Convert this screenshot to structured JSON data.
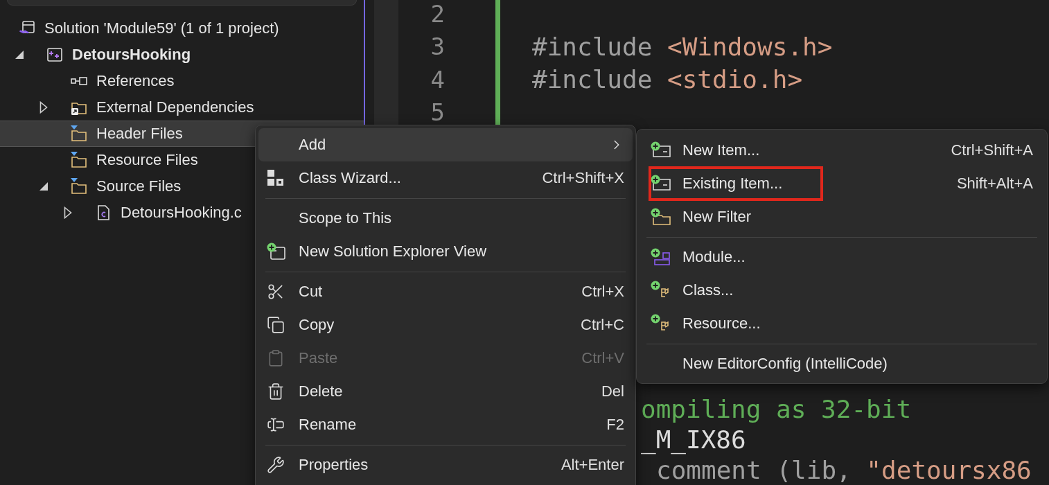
{
  "tree": [
    {
      "label": "Solution 'Module59' (1 of 1 project)",
      "kind": "solution",
      "selected": false,
      "children": [
        {
          "label": "DetoursHooking",
          "kind": "project",
          "selected": false,
          "expanded": true,
          "children": [
            {
              "label": "References",
              "kind": "references",
              "selected": false
            },
            {
              "label": "External Dependencies",
              "kind": "external",
              "selected": false,
              "expanded": false
            },
            {
              "label": "Header Files",
              "kind": "filter",
              "selected": true
            },
            {
              "label": "Resource Files",
              "kind": "filter",
              "selected": false
            },
            {
              "label": "Source Files",
              "kind": "filter",
              "selected": false,
              "expanded": true,
              "children": [
                {
                  "label": "DetoursHooking.c",
                  "kind": "cfile",
                  "selected": false,
                  "expanded": false
                }
              ]
            }
          ]
        }
      ]
    }
  ],
  "editor": {
    "lines": [
      {
        "number": "2"
      },
      {
        "number": "3",
        "tokens": [
          {
            "text": "#include",
            "kind": "directive"
          },
          {
            "text": "<Windows.h>",
            "kind": "string"
          }
        ]
      },
      {
        "number": "4",
        "tokens": [
          {
            "text": "#include",
            "kind": "directive"
          },
          {
            "text": "<stdio.h>",
            "kind": "string"
          }
        ]
      },
      {
        "number": "5"
      }
    ],
    "partial_lines": [
      {
        "tokens": [
          {
            "text": "ompiling as 32-bit",
            "kind": "comment"
          }
        ]
      },
      {
        "tokens": [
          {
            "text": "_M_IX86",
            "kind": "plain"
          }
        ]
      },
      {
        "tokens": [
          {
            "text": "comment (lib,",
            "kind": "directive"
          },
          {
            "text": "\"detoursx86",
            "kind": "string"
          }
        ]
      }
    ]
  },
  "context_menu": {
    "items": [
      {
        "kind": "item",
        "label": "Add",
        "submenu": true,
        "selected": true,
        "disabled": false
      },
      {
        "kind": "item",
        "label": "Class Wizard...",
        "shortcut": "Ctrl+Shift+X",
        "selected": false,
        "disabled": false
      },
      {
        "kind": "separator"
      },
      {
        "kind": "item",
        "label": "Scope to This",
        "selected": false,
        "disabled": false
      },
      {
        "kind": "item",
        "label": "New Solution Explorer View",
        "selected": false,
        "disabled": false
      },
      {
        "kind": "separator"
      },
      {
        "kind": "item",
        "label": "Cut",
        "shortcut": "Ctrl+X",
        "selected": false,
        "disabled": false
      },
      {
        "kind": "item",
        "label": "Copy",
        "shortcut": "Ctrl+C",
        "selected": false,
        "disabled": false
      },
      {
        "kind": "item",
        "label": "Paste",
        "shortcut": "Ctrl+V",
        "selected": false,
        "disabled": true
      },
      {
        "kind": "item",
        "label": "Delete",
        "shortcut": "Del",
        "selected": false,
        "disabled": false
      },
      {
        "kind": "item",
        "label": "Rename",
        "shortcut": "F2",
        "selected": false,
        "disabled": false
      },
      {
        "kind": "separator"
      },
      {
        "kind": "item",
        "label": "Properties",
        "shortcut": "Alt+Enter",
        "selected": false,
        "disabled": false
      }
    ]
  },
  "add_submenu": {
    "items": [
      {
        "kind": "item",
        "label": "New Item...",
        "shortcut": "Ctrl+Shift+A",
        "annotated": false
      },
      {
        "kind": "item",
        "label": "Existing Item...",
        "shortcut": "Shift+Alt+A",
        "annotated": true
      },
      {
        "kind": "item",
        "label": "New Filter",
        "annotated": false
      },
      {
        "kind": "separator"
      },
      {
        "kind": "item",
        "label": "Module...",
        "annotated": false
      },
      {
        "kind": "item",
        "label": "Class...",
        "annotated": false
      },
      {
        "kind": "item",
        "label": "Resource...",
        "annotated": false
      },
      {
        "kind": "separator"
      },
      {
        "kind": "item",
        "label": "New EditorConfig (IntelliCode)",
        "annotated": false
      }
    ]
  }
}
